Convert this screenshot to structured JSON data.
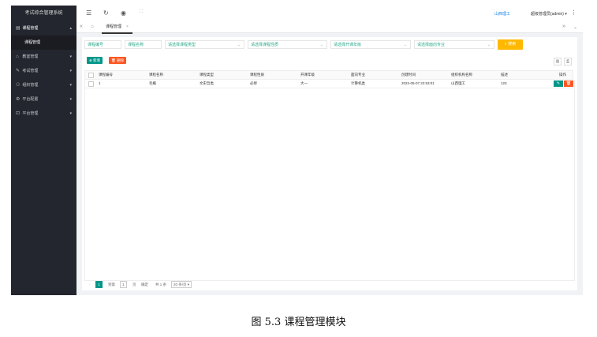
{
  "app": {
    "title": "考试综合管理系统"
  },
  "sidebar": {
    "items": [
      {
        "icon": "list-icon",
        "glyph": "▤",
        "label": "课程管理",
        "open": true
      },
      {
        "icon": "home-icon",
        "glyph": "⌂",
        "label": "教室管理"
      },
      {
        "icon": "pencil-icon",
        "glyph": "✎",
        "label": "考试管理"
      },
      {
        "icon": "users-icon",
        "glyph": "⚇",
        "label": "组织管理"
      },
      {
        "icon": "gear-icon",
        "glyph": "⚙",
        "label": "平台配置"
      },
      {
        "icon": "lock-icon",
        "glyph": "⊡",
        "label": "平台管理"
      }
    ],
    "sub_item": "课程管理"
  },
  "topbar": {
    "org": "山西理工",
    "user": "超级管理员(admin)"
  },
  "tabs": [
    {
      "label": "课程管理"
    }
  ],
  "filters": {
    "code_placeholder": "课程编号",
    "name_placeholder": "课程名称",
    "type_placeholder": "请选择课程类型",
    "nature_placeholder": "请选择课程性质",
    "grade_placeholder": "请选择开课年级",
    "major_placeholder": "请选择面向专业",
    "search_label": "搜索"
  },
  "toolbar": {
    "add_label": "新增",
    "delete_label": "删除"
  },
  "table": {
    "headers": [
      "课程编号",
      "课程名称",
      "课程类型",
      "课程性质",
      "开课年级",
      "面向专业",
      "创建时间",
      "组织机构名称",
      "描述",
      "操作"
    ],
    "rows": [
      [
        "1",
        "毛概",
        "文史哲类",
        "必修",
        "大一",
        "计算机类",
        "2022-05-07 22:53:01",
        "山西理工",
        "123"
      ]
    ]
  },
  "pagination": {
    "prev": "‹",
    "current": "1",
    "goto_label": "到第",
    "page_input": "1",
    "page_unit": "页",
    "confirm": "确定",
    "total": "共 1 条",
    "page_size": "20 条/页 ▾"
  },
  "caption": "图 5.3 课程管理模块",
  "colors": {
    "accent": "#009688",
    "danger": "#ff5722",
    "warn": "#ffb800",
    "sidebar": "#23262e"
  }
}
